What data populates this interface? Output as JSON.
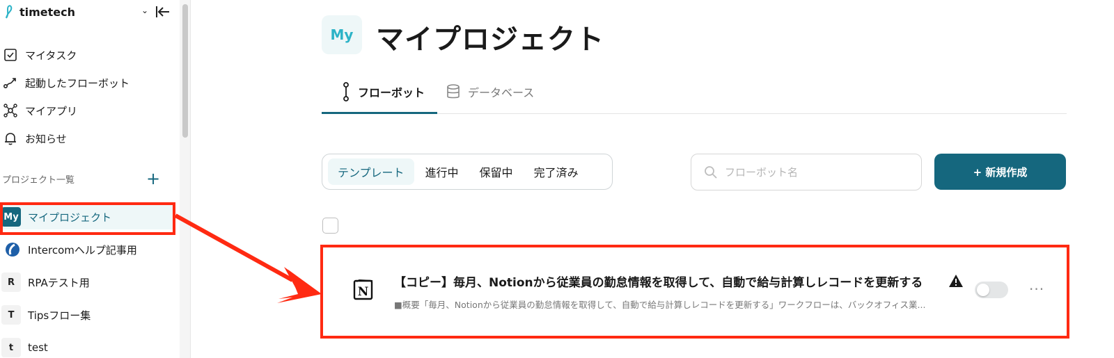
{
  "sidebar": {
    "brand": "timetech",
    "nav": [
      {
        "label": "マイタスク",
        "icon": "checkbox-icon"
      },
      {
        "label": "起動したフローボット",
        "icon": "flow-icon"
      },
      {
        "label": "マイアプリ",
        "icon": "network-icon"
      },
      {
        "label": "お知らせ",
        "icon": "bell-icon"
      }
    ],
    "projects_heading": "プロジェクト一覧",
    "add_project_label": "+",
    "projects": [
      {
        "badge": "My",
        "label": "マイプロジェクト"
      },
      {
        "badge": "",
        "label": "Intercomヘルプ記事用"
      },
      {
        "badge": "R",
        "label": "RPAテスト用"
      },
      {
        "badge": "T",
        "label": "Tipsフロー集"
      },
      {
        "badge": "t",
        "label": "test"
      }
    ]
  },
  "header": {
    "badge": "My",
    "title": "マイプロジェクト"
  },
  "tabs": [
    {
      "label": "フローボット"
    },
    {
      "label": "データベース"
    }
  ],
  "filters": [
    "テンプレート",
    "進行中",
    "保留中",
    "完了済み"
  ],
  "search": {
    "placeholder": "フローボット名"
  },
  "new_button": "+ 新規作成",
  "flowbot_row": {
    "title": "【コピー】毎月、Notionから従業員の勤怠情報を取得して、自動で給与計算しレコードを更新する",
    "description": "■概要「毎月、Notionから従業員の勤怠情報を取得して、自動で給与計算しレコードを更新する」ワークフローは、バックオフィス業...",
    "icon_letter": "N",
    "more_label": "···"
  },
  "colors": {
    "primary": "#15677e",
    "accent": "#2db3c7",
    "highlight": "#ff2a12"
  }
}
